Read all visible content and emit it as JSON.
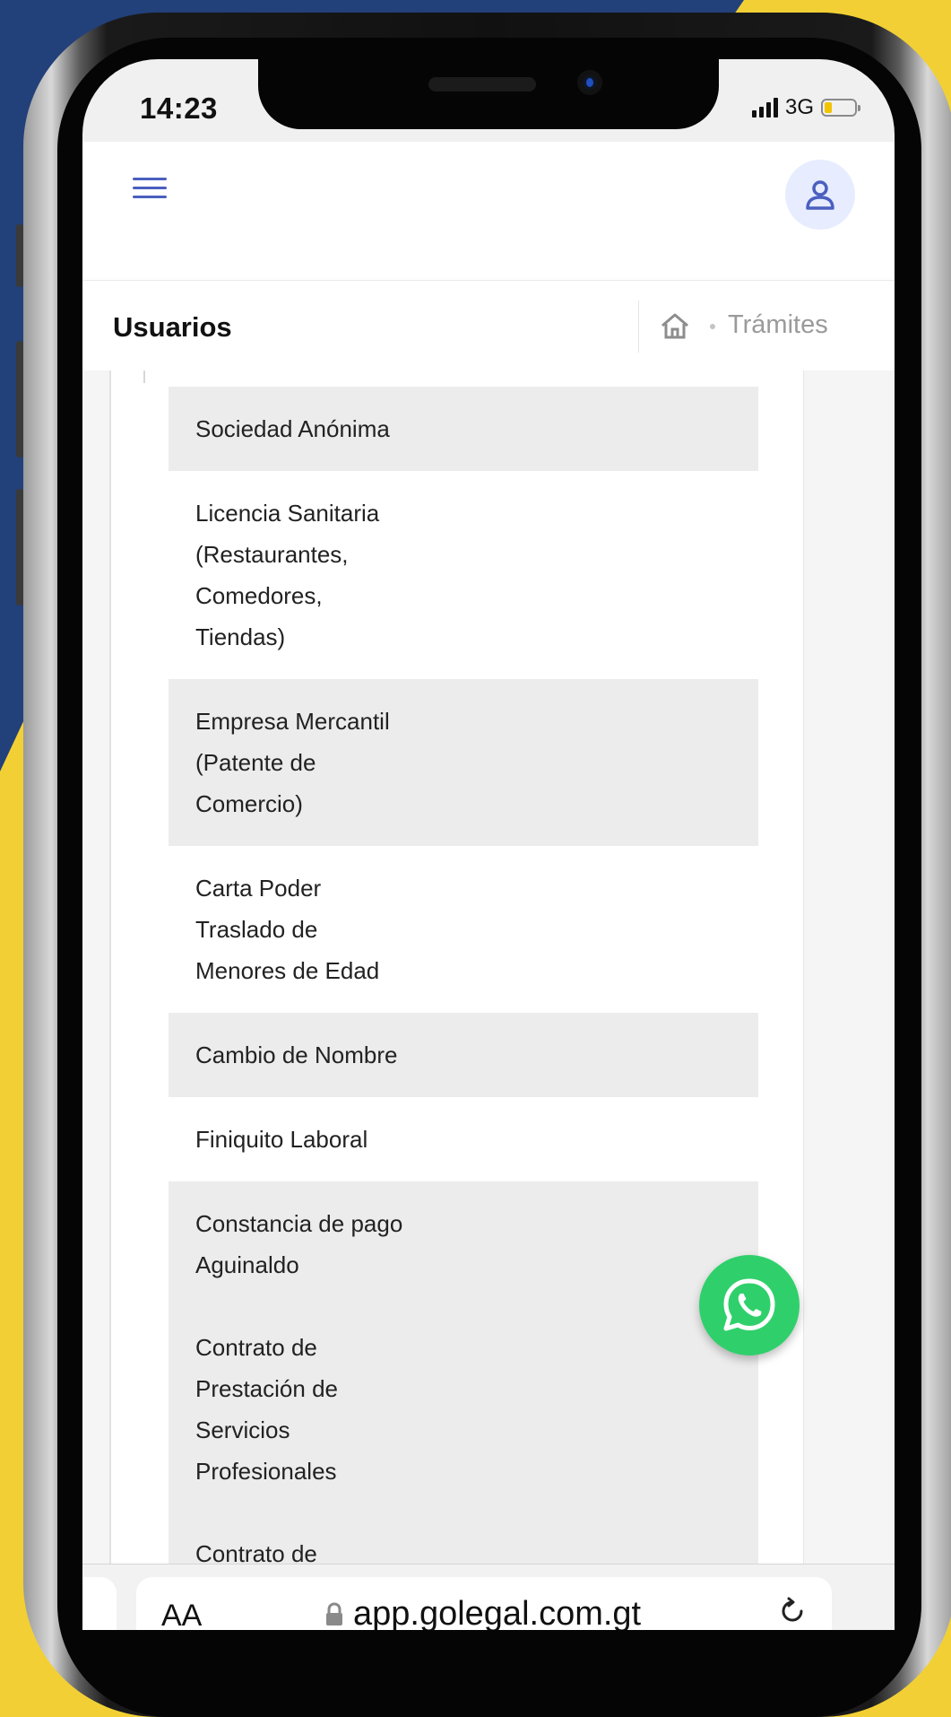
{
  "status_bar": {
    "time": "14:23",
    "network": "3G"
  },
  "header": {
    "menu_icon": "hamburger-menu-icon",
    "avatar_icon": "user-icon"
  },
  "title_bar": {
    "title": "Usuarios",
    "breadcrumb_home_icon": "home-icon",
    "breadcrumb_current": "Trámites"
  },
  "list": {
    "items": [
      "Sociedad Anónima",
      "Licencia Sanitaria\n(Restaurantes,\nComedores,\nTiendas)",
      "Empresa Mercantil\n(Patente de\nComercio)",
      "Carta Poder\nTraslado de\nMenores de Edad",
      "Cambio de Nombre",
      "Finiquito Laboral",
      "Constancia de pago\nAguinaldo\n\nContrato de\nPrestación de\nServicios\nProfesionales\n\nContrato de"
    ]
  },
  "fab": {
    "icon": "whatsapp-icon"
  },
  "browser": {
    "text_size_label": "AA",
    "url": "app.golegal.com.gt",
    "lock_icon": "lock-icon",
    "reload_icon": "reload-icon"
  },
  "colors": {
    "accent": "#4a5fbf",
    "whatsapp": "#2fd06b",
    "background_yellow": "#f2d035",
    "background_blue": "#22407a"
  }
}
